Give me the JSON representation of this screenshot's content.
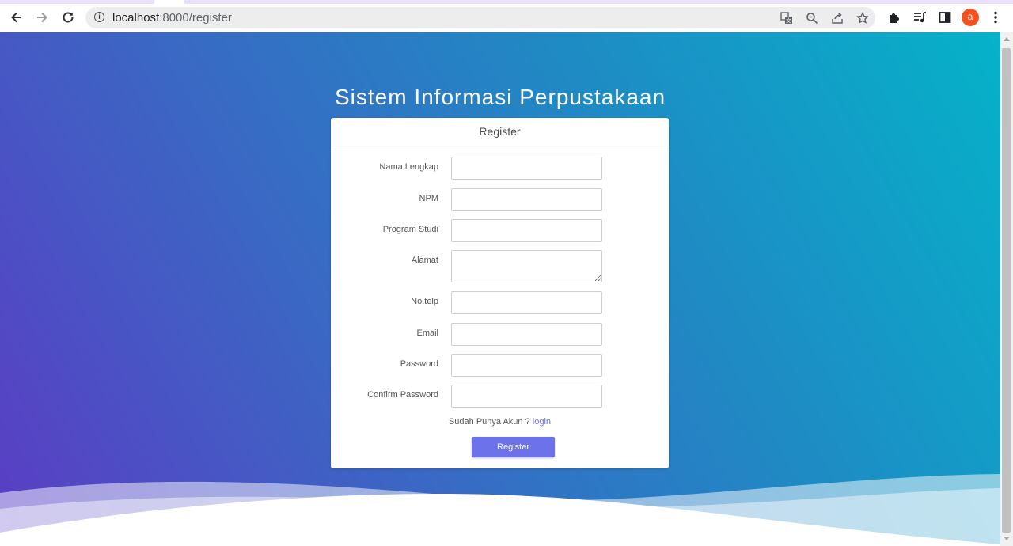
{
  "browser": {
    "url_host": "localhost",
    "url_path": ":8000/register",
    "avatar_letter": "a",
    "accent_color": "#f4511e",
    "icons": [
      "back-icon",
      "forward-icon",
      "reload-icon",
      "info-icon",
      "translate-icon",
      "zoom-icon",
      "share-icon",
      "bookmark-star-icon",
      "extensions-icon",
      "media-controls-icon",
      "side-panel-icon",
      "menu-kebab-icon"
    ]
  },
  "page": {
    "title": "Sistem Informasi Perpustakaan",
    "card_header": "Register",
    "fields": [
      {
        "label": "Nama Lengkap",
        "value": ""
      },
      {
        "label": "NPM",
        "value": ""
      },
      {
        "label": "Program Studi",
        "value": ""
      },
      {
        "label": "Alamat",
        "value": ""
      },
      {
        "label": "No.telp",
        "value": ""
      },
      {
        "label": "Email",
        "value": ""
      },
      {
        "label": "Password",
        "value": ""
      },
      {
        "label": "Confirm Password",
        "value": ""
      }
    ],
    "login_prompt": "Sudah Punya Akun ?",
    "login_link": "login",
    "submit_label": "Register",
    "button_color": "#6c72ea"
  }
}
